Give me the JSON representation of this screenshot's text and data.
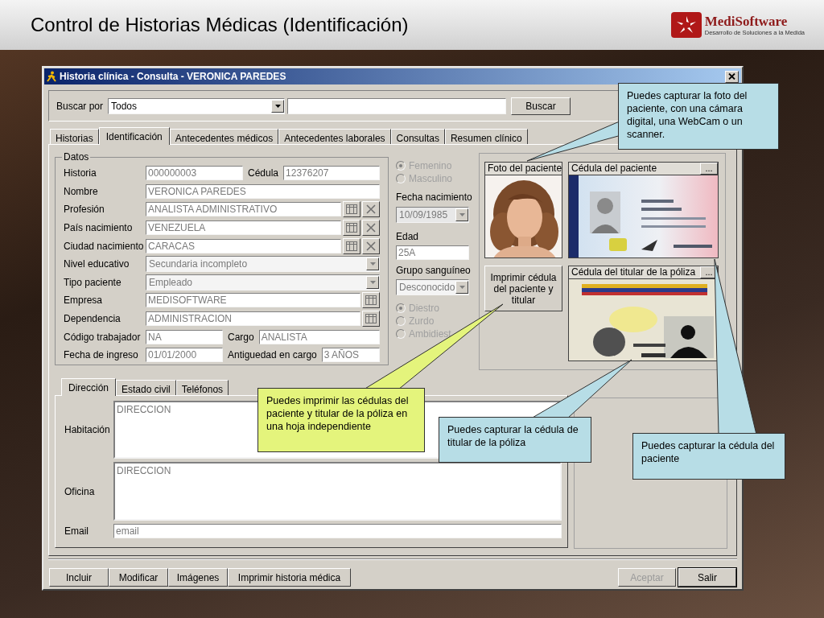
{
  "slide": {
    "title": "Control de Historias Médicas (Identificación)",
    "logo_name": "MediSoftware",
    "logo_tagline": "Desarrollo de Soluciones a la Medida"
  },
  "window": {
    "title": "Historia clínica - Consulta - VERONICA PAREDES"
  },
  "search": {
    "label": "Buscar por",
    "combo_value": "Todos",
    "button": "Buscar"
  },
  "tabs": [
    {
      "label": "Historias",
      "selected": false
    },
    {
      "label": "Identificación",
      "selected": true
    },
    {
      "label": "Antecedentes médicos",
      "selected": false
    },
    {
      "label": "Antecedentes laborales",
      "selected": false
    },
    {
      "label": "Consultas",
      "selected": false
    },
    {
      "label": "Resumen clínico",
      "selected": false
    }
  ],
  "datos": {
    "title": "Datos",
    "rows": [
      {
        "kind": "pair",
        "label": "Historia",
        "value": "000000003",
        "label2": "Cédula",
        "value2": "12376207"
      },
      {
        "kind": "text",
        "label": "Nombre",
        "value": "VERONICA PAREDES"
      },
      {
        "kind": "lookup_clear",
        "label": "Profesión",
        "value": "ANALISTA ADMINISTRATIVO"
      },
      {
        "kind": "lookup_clear",
        "label": "País nacimiento",
        "value": "VENEZUELA"
      },
      {
        "kind": "lookup_clear",
        "label": "Ciudad nacimiento",
        "value": "CARACAS"
      },
      {
        "kind": "combo",
        "label": "Nivel educativo",
        "value": "Secundaria incompleto"
      },
      {
        "kind": "combo",
        "label": "Tipo paciente",
        "value": "Empleado"
      },
      {
        "kind": "lookup",
        "label": "Empresa",
        "value": "MEDISOFTWARE"
      },
      {
        "kind": "lookup",
        "label": "Dependencia",
        "value": "ADMINISTRACION"
      },
      {
        "kind": "pair",
        "label": "Código trabajador",
        "value": "NA",
        "label2": "Cargo",
        "value2": "ANALISTA"
      },
      {
        "kind": "pair",
        "label": "Fecha de ingreso",
        "value": "01/01/2000",
        "label2": "Antiguedad en cargo",
        "value2": "3 AÑOS"
      }
    ]
  },
  "sexo": [
    {
      "label": "Femenino",
      "selected": true,
      "disabled": true
    },
    {
      "label": "Masculino",
      "selected": false,
      "disabled": true
    }
  ],
  "fecha_nacimiento": {
    "label": "Fecha nacimiento",
    "value": "10/09/1985"
  },
  "edad": {
    "label": "Edad",
    "value": "25A"
  },
  "grupo_sanguineo": {
    "label": "Grupo sanguíneo",
    "value": "Desconocido"
  },
  "lateralidad": [
    {
      "label": "Diestro",
      "selected": true,
      "disabled": true
    },
    {
      "label": "Zurdo",
      "selected": false,
      "disabled": true
    },
    {
      "label": "Ambidiest",
      "selected": false,
      "disabled": true
    }
  ],
  "images": {
    "photo_title": "Foto del paciente",
    "id_title": "Cédula del paciente",
    "id_browse": "...",
    "print_button": "Imprimir cédula del paciente y titular",
    "holder_title": "Cédula del titular de la póliza",
    "holder_browse": "..."
  },
  "address_tabs": [
    {
      "label": "Dirección",
      "selected": true
    },
    {
      "label": "Estado civil",
      "selected": false
    },
    {
      "label": "Teléfonos",
      "selected": false
    }
  ],
  "address": {
    "habitacion_label": "Habitación",
    "habitacion": "DIRECCION",
    "oficina_label": "Oficina",
    "oficina": "DIRECCION",
    "email_label": "Email",
    "email": "email"
  },
  "buttons": [
    {
      "label": "Incluir"
    },
    {
      "label": "Modificar"
    },
    {
      "label": "Imágenes"
    },
    {
      "label": "Imprimir historia médica"
    }
  ],
  "dialog_buttons": [
    {
      "label": "Aceptar",
      "disabled": true
    },
    {
      "label": "Salir",
      "disabled": false
    }
  ],
  "callouts": [
    {
      "text": "Puedes capturar la foto del paciente, con una cámara digital, una WebCam o un scanner.",
      "color": "#b7dde6"
    },
    {
      "text": "Puedes imprimir las cédulas del paciente y titular de la póliza en una hoja independiente",
      "color": "#e4f47c"
    },
    {
      "text": "Puedes capturar la cédula de titular de la póliza",
      "color": "#b7dde6"
    },
    {
      "text": "Puedes capturar la cédula del paciente",
      "color": "#b7dde6"
    }
  ]
}
